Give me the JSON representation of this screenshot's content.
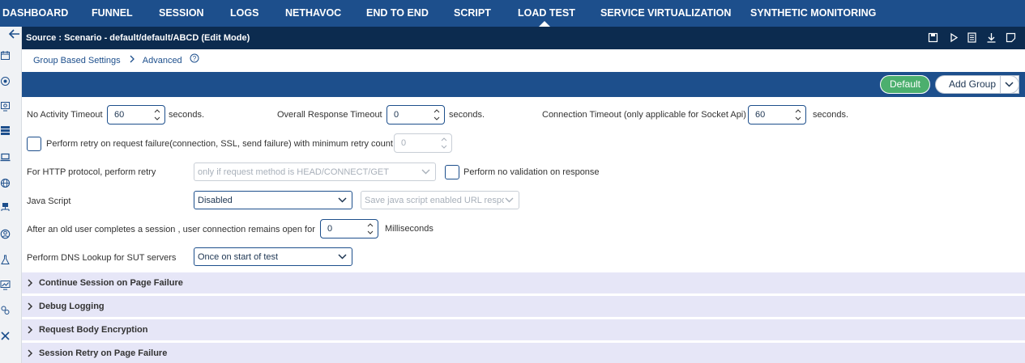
{
  "nav": {
    "tabs": [
      {
        "label": "DASHBOARD"
      },
      {
        "label": "FUNNEL"
      },
      {
        "label": "SESSION"
      },
      {
        "label": "LOGS"
      },
      {
        "label": "NETHAVOC"
      },
      {
        "label": "END TO END"
      },
      {
        "label": "SCRIPT"
      },
      {
        "label": "LOAD TEST",
        "active": true
      },
      {
        "label": "SERVICE VIRTUALIZATION"
      },
      {
        "label": "SYNTHETIC MONITORING"
      }
    ]
  },
  "sidebar": {
    "icons": [
      "back-arrow-icon",
      "calendar-icon",
      "eye-icon",
      "monitor-icon",
      "server-icon",
      "laptop-icon",
      "globe-icon",
      "network-icon",
      "user-icon",
      "flask-icon",
      "chart-icon",
      "settings-cluster-icon",
      "tools-icon"
    ]
  },
  "source_bar": {
    "title": "Source : Scenario - default/default/ABCD (Edit Mode)",
    "icons": [
      "save-icon",
      "play-icon",
      "document-icon",
      "download-icon",
      "note-icon"
    ]
  },
  "breadcrumb": {
    "item1": "Group Based Settings",
    "item2": "Advanced"
  },
  "group_bar": {
    "default_label": "Default",
    "add_group_label": "Add Group"
  },
  "form": {
    "no_activity_timeout": {
      "label": "No Activity Timeout",
      "value": "60",
      "unit": "seconds."
    },
    "overall_response_timeout": {
      "label": "Overall Response Timeout",
      "value": "0",
      "unit": "seconds."
    },
    "connection_timeout": {
      "label": "Connection Timeout (only applicable for Socket Api)",
      "value": "60",
      "unit": "seconds."
    },
    "retry": {
      "label": "Perform retry on request failure(connection, SSL, send failure) with minimum retry count",
      "value": "0",
      "checked": false
    },
    "http_retry": {
      "label": "For HTTP protocol, perform retry",
      "value": "only if request method is HEAD/CONNECT/GET"
    },
    "no_validation": {
      "label": "Perform no validation on response",
      "checked": false
    },
    "java_script": {
      "label": "Java Script",
      "value": "Disabled",
      "secondary_value": "Save java script enabled URL respo"
    },
    "connection_open": {
      "label": "After an old user completes a session , user connection remains open for",
      "value": "0",
      "unit": "Milliseconds"
    },
    "dns_lookup": {
      "label": "Perform DNS Lookup for SUT servers",
      "value": "Once on start of test"
    }
  },
  "accordions": [
    {
      "label": "Continue Session on Page Failure"
    },
    {
      "label": "Debug Logging"
    },
    {
      "label": "Request Body Encryption"
    },
    {
      "label": "Session Retry on Page Failure"
    }
  ],
  "colors": {
    "nav_bg": "#1d4f8c",
    "source_bar_bg": "#0c2b4f",
    "default_btn": "#4caf6e",
    "accordion_bg": "#e6e6f7"
  }
}
